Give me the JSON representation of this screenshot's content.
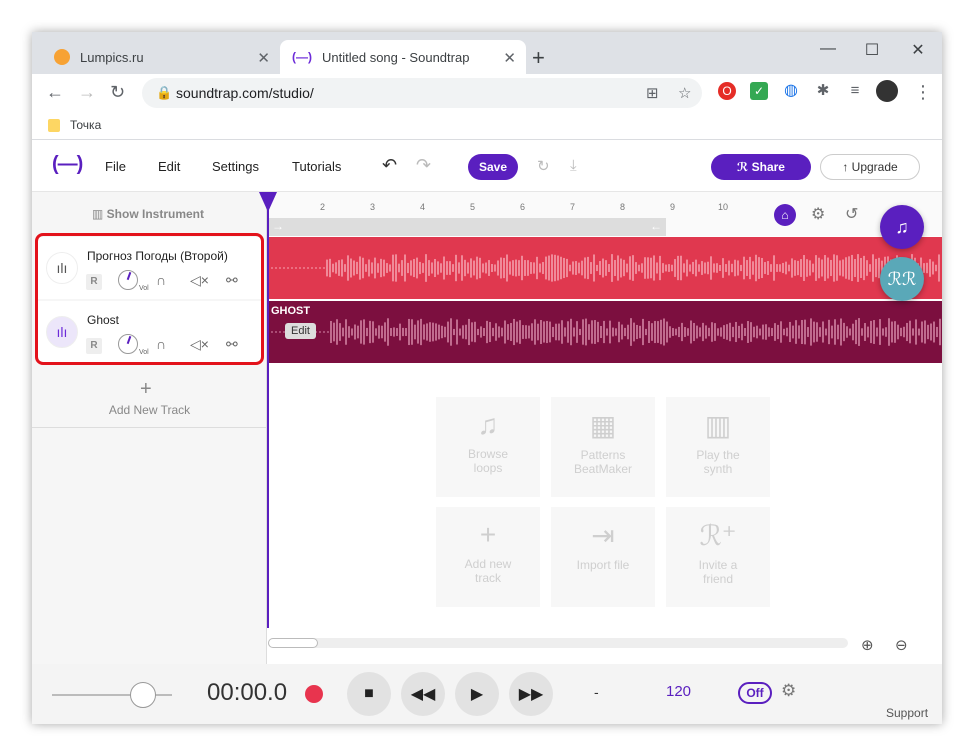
{
  "browser": {
    "tabs": [
      {
        "title": "Lumpics.ru"
      },
      {
        "title": "Untitled song - Soundtrap"
      }
    ],
    "url": "soundtrap.com/studio/",
    "bookmark": "Точка"
  },
  "app": {
    "logo": "(—)",
    "menu": [
      "File",
      "Edit",
      "Settings",
      "Tutorials"
    ],
    "save_label": "Save",
    "share_label": "Share",
    "upgrade_label": "Upgrade",
    "show_instrument": "Show Instrument",
    "tracks": [
      {
        "name": "Прогноз Погоды (Второй)",
        "record": "R",
        "vol": "Vol"
      },
      {
        "name": "Ghost",
        "record": "R",
        "vol": "Vol"
      }
    ],
    "add_track": "Add New Track",
    "ruler_ticks": [
      "2",
      "3",
      "4",
      "5",
      "6",
      "7",
      "8",
      "9",
      "10"
    ],
    "regions": [
      {
        "label": "",
        "color": "#e0384f"
      },
      {
        "label": "GHOST",
        "edit": "Edit",
        "color": "#7c0f3f"
      }
    ],
    "cards": [
      {
        "line1": "Browse",
        "line2": "loops",
        "icon": "music-note-icon"
      },
      {
        "line1": "Patterns",
        "line2": "BeatMaker",
        "icon": "grid-icon"
      },
      {
        "line1": "Play the",
        "line2": "synth",
        "icon": "keyboard-icon"
      },
      {
        "line1": "Add new",
        "line2": "track",
        "icon": "plus-icon"
      },
      {
        "line1": "Import file",
        "line2": "",
        "icon": "import-icon"
      },
      {
        "line1": "Invite a",
        "line2": "friend",
        "icon": "invite-icon"
      }
    ]
  },
  "transport": {
    "time": "00:00.0",
    "key": "-",
    "tempo": "120",
    "metronome": "Off",
    "support": "Support"
  },
  "colors": {
    "accent": "#5a1fbf",
    "track1": "#e0384f",
    "track2": "#7c0f3f",
    "highlight": "#e3121b"
  }
}
